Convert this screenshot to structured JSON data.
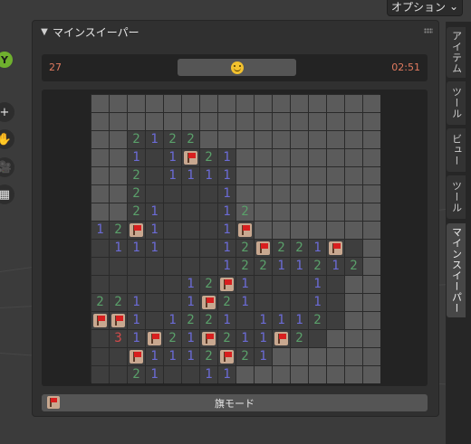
{
  "header_menu": {
    "options_label": "オプション"
  },
  "toolbar": {
    "items": [
      {
        "icon": "y-axis-gizmo-icon",
        "glyph": "Y"
      },
      {
        "icon": "zoom-icon",
        "glyph": "+"
      },
      {
        "icon": "hand-pan-icon",
        "glyph": "✋"
      },
      {
        "icon": "camera-icon",
        "glyph": "🎥"
      },
      {
        "icon": "grid-view-icon",
        "glyph": "▦"
      }
    ]
  },
  "side_tabs": [
    {
      "label": "アイテム",
      "active": false
    },
    {
      "label": "ツール",
      "active": false
    },
    {
      "label": "ビュー",
      "active": false
    },
    {
      "label": "ツール",
      "active": false
    },
    {
      "label": "マインスイーパー",
      "active": true
    }
  ],
  "panel": {
    "title": "マインスイーパー",
    "mines_remaining": "27",
    "timer": "02:51",
    "flag_mode_label": "旗モード"
  },
  "board": {
    "rows": [
      "________________",
      "________________",
      "__2122__________",
      "__1_1F21________",
      "__2_1111________",
      "__2____1________",
      "__21___12_______",
      "12F1___1F_______",
      "_111___12F221F__",
      "_______12211212_",
      "_____12F1___1___",
      "221__1F21___1___",
      "FF1_1221_1112___",
      "_31F21F211F2____",
      "__F1112F21______",
      "__21__11________"
    ],
    "revealed_rows": [
      "________________",
      "________________",
      "__RRRR__________",
      "__RRRRRR________",
      "__RRRRRR________",
      "__RRRRRR________",
      "__RRRRRR________",
      "RRRRRRRRR_______",
      "RRRRRRRRRRRRRRR_",
      "RRRRRRRRRRRRRRR_",
      "RRRRRRRRRRRRRR__",
      "RRRRRRRRRRRRRR__",
      "RRRRRRRRRRRRRR__",
      "RRRRRRRRRRRRR___",
      "RRRRRRRRRR______",
      "RRRRRRRR________"
    ]
  }
}
